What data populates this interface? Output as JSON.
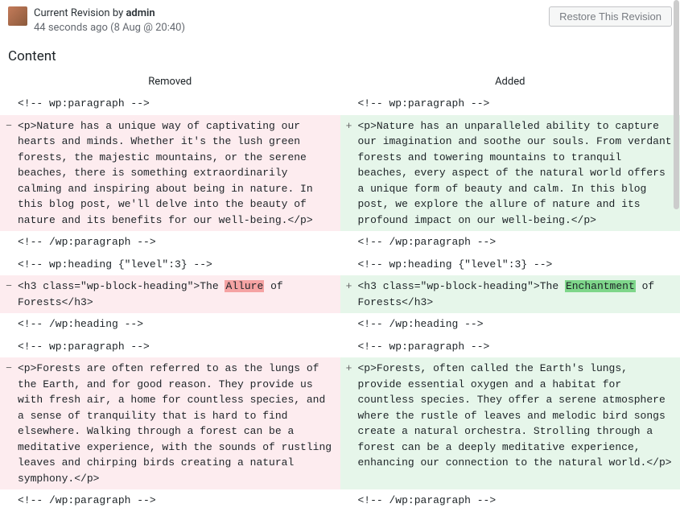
{
  "header": {
    "title_prefix": "Current Revision by ",
    "author": "admin",
    "timestamp": "44 seconds ago (8 Aug @ 20:40)",
    "restore_label": "Restore This Revision"
  },
  "content_label": "Content",
  "columns": {
    "removed": "Removed",
    "added": "Added"
  },
  "rows": [
    {
      "type": "ctx",
      "l": "<!-- wp:paragraph -->",
      "r": "<!-- wp:paragraph -->"
    },
    {
      "type": "chg",
      "l": "<p>Nature has a unique way of captivating our hearts and minds. Whether it's the lush green forests, the majestic mountains, or the serene beaches, there is something extraordinarily calming and inspiring about being in nature. In this blog post, we'll delve into the beauty of nature and its benefits for our well-being.</p>",
      "r": "<p>Nature has an unparalleled ability to capture our imagination and soothe our souls. From verdant forests and towering mountains to tranquil beaches, every aspect of the natural world offers a unique form of beauty and calm. In this blog post, we explore the allure of nature and its profound impact on our well-being.</p>"
    },
    {
      "type": "ctx",
      "l": "<!-- /wp:paragraph -->",
      "r": "<!-- /wp:paragraph -->"
    },
    {
      "type": "ctx",
      "l": "<!-- wp:heading {\"level\":3} -->",
      "r": "<!-- wp:heading {\"level\":3} -->"
    },
    {
      "type": "chg",
      "l_parts": [
        "<h3 class=\"wp-block-heading\">The ",
        "Allure",
        " of Forests</h3>"
      ],
      "r_parts": [
        "<h3 class=\"wp-block-heading\">The ",
        "Enchantment",
        " of Forests</h3>"
      ]
    },
    {
      "type": "ctx",
      "l": "<!-- /wp:heading -->",
      "r": "<!-- /wp:heading -->"
    },
    {
      "type": "ctx",
      "l": "<!-- wp:paragraph -->",
      "r": "<!-- wp:paragraph -->"
    },
    {
      "type": "chg",
      "l": "<p>Forests are often referred to as the lungs of the Earth, and for good reason. They provide us with fresh air, a home for countless species, and a sense of tranquility that is hard to find elsewhere. Walking through a forest can be a meditative experience, with the sounds of rustling leaves and chirping birds creating a natural symphony.</p>",
      "r": "<p>Forests, often called the Earth's lungs, provide essential oxygen and a habitat for countless species. They offer a serene atmosphere where the rustle of leaves and melodic bird songs create a natural orchestra. Strolling through a forest can be a deeply meditative experience, enhancing our connection to the natural world.</p>"
    },
    {
      "type": "ctx",
      "l": "<!-- /wp:paragraph -->",
      "r": "<!-- /wp:paragraph -->"
    }
  ]
}
